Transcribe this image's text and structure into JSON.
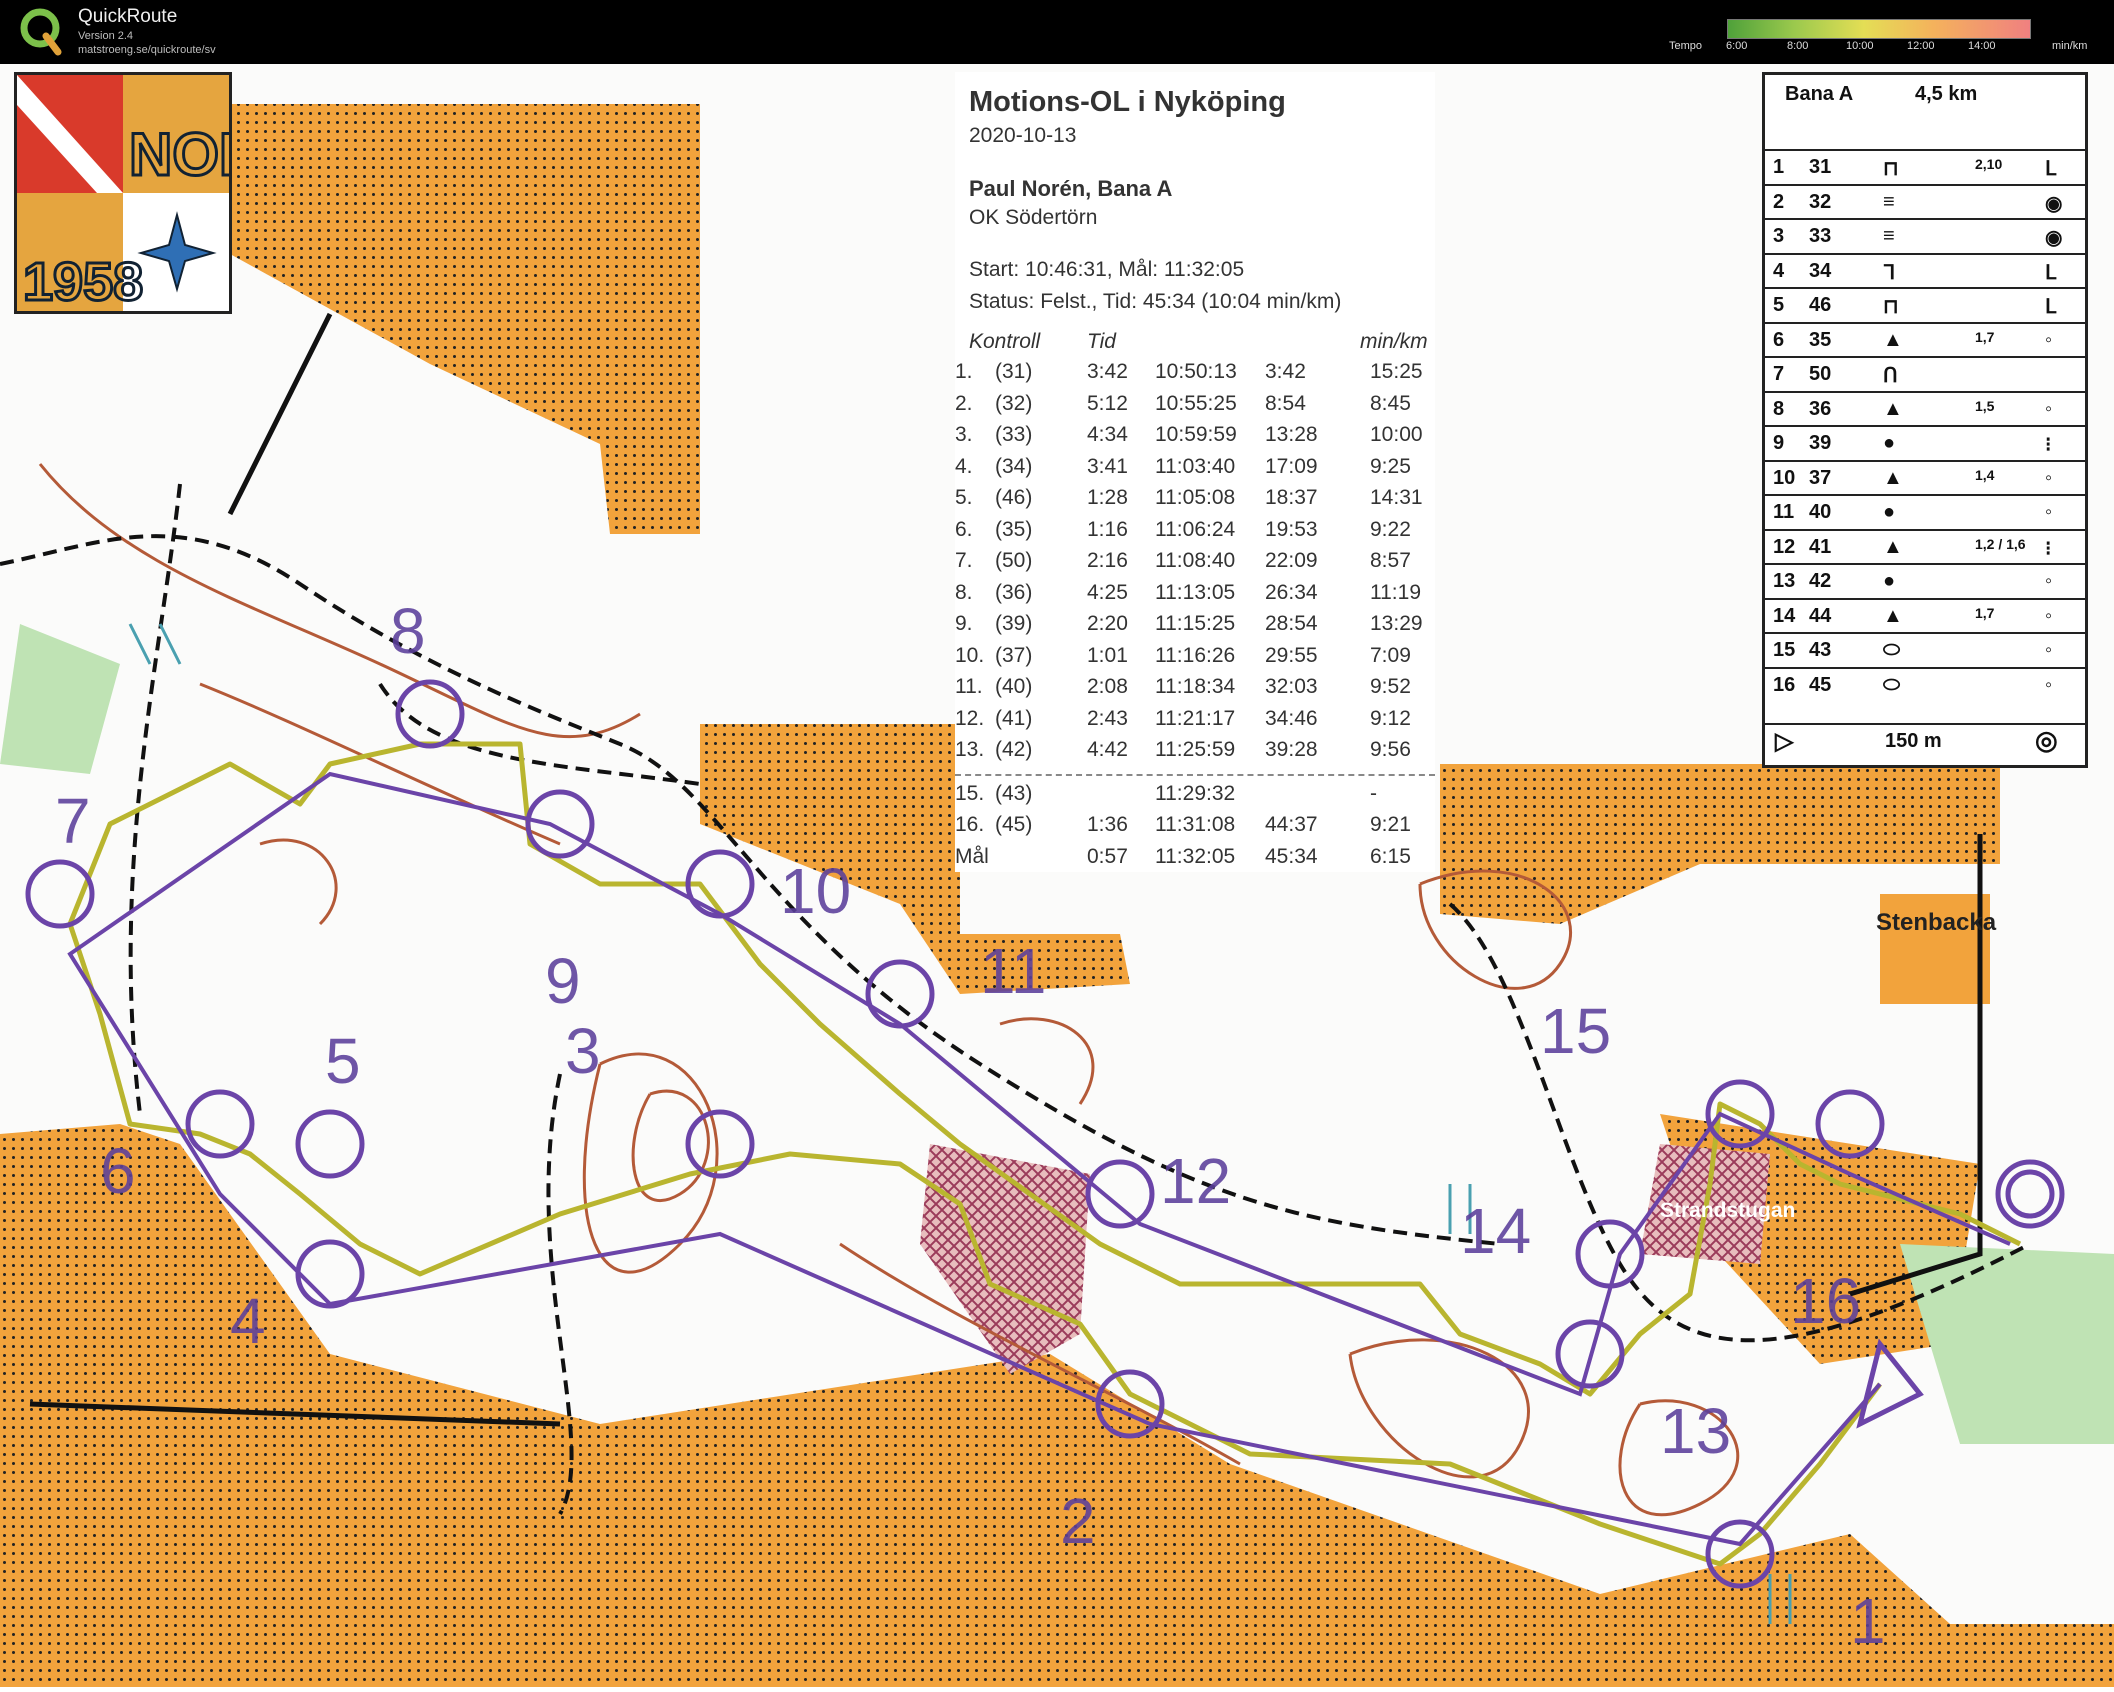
{
  "app": {
    "title": "QuickRoute",
    "version": "Version 2.4",
    "url": "matstroeng.se/quickroute/sv"
  },
  "tempo_legend": {
    "label": "Tempo",
    "ticks": [
      "6:00",
      "8:00",
      "10:00",
      "12:00",
      "14:00"
    ],
    "unit": "min/km"
  },
  "club_logo": {
    "top_text": "NOK",
    "year": "1958"
  },
  "results": {
    "title": "Motions-OL i Nyköping",
    "date": "2020-10-13",
    "runner": "Paul Norén, Bana A",
    "club": "OK Södertörn",
    "start_finish": "Start: 10:46:31, Mål: 11:32:05",
    "status": "Status: Felst., Tid: 45:34 (10:04 min/km)",
    "headers": [
      "Kontroll",
      "Tid",
      "min/km"
    ],
    "splits": [
      [
        "1.",
        "(31)",
        "3:42",
        "10:50:13",
        "3:42",
        "15:25"
      ],
      [
        "2.",
        "(32)",
        "5:12",
        "10:55:25",
        "8:54",
        "8:45"
      ],
      [
        "3.",
        "(33)",
        "4:34",
        "10:59:59",
        "13:28",
        "10:00"
      ],
      [
        "4.",
        "(34)",
        "3:41",
        "11:03:40",
        "17:09",
        "9:25"
      ],
      [
        "5.",
        "(46)",
        "1:28",
        "11:05:08",
        "18:37",
        "14:31"
      ],
      [
        "6.",
        "(35)",
        "1:16",
        "11:06:24",
        "19:53",
        "9:22"
      ],
      [
        "7.",
        "(50)",
        "2:16",
        "11:08:40",
        "22:09",
        "8:57"
      ],
      [
        "8.",
        "(36)",
        "4:25",
        "11:13:05",
        "26:34",
        "11:19"
      ],
      [
        "9.",
        "(39)",
        "2:20",
        "11:15:25",
        "28:54",
        "13:29"
      ],
      [
        "10.",
        "(37)",
        "1:01",
        "11:16:26",
        "29:55",
        "7:09"
      ],
      [
        "11.",
        "(40)",
        "2:08",
        "11:18:34",
        "32:03",
        "9:52"
      ],
      [
        "12.",
        "(41)",
        "2:43",
        "11:21:17",
        "34:46",
        "9:12"
      ],
      [
        "13.",
        "(42)",
        "4:42",
        "11:25:59",
        "39:28",
        "9:56"
      ],
      [
        "15.",
        "(43)",
        "",
        "11:29:32",
        "",
        "-"
      ],
      [
        "16.",
        "(45)",
        "1:36",
        "11:31:08",
        "44:37",
        "9:21"
      ],
      [
        "Mål",
        "",
        "0:57",
        "11:32:05",
        "45:34",
        "6:15"
      ]
    ]
  },
  "description": {
    "course": "Bana A",
    "length": "4,5 km",
    "rows": [
      [
        "1",
        "31",
        "2,10"
      ],
      [
        "2",
        "32",
        ""
      ],
      [
        "3",
        "33",
        ""
      ],
      [
        "4",
        "34",
        ""
      ],
      [
        "5",
        "46",
        ""
      ],
      [
        "6",
        "35",
        "1,7"
      ],
      [
        "7",
        "50",
        ""
      ],
      [
        "8",
        "36",
        "1,5"
      ],
      [
        "9",
        "39",
        ""
      ],
      [
        "10",
        "37",
        "1,4"
      ],
      [
        "11",
        "40",
        ""
      ],
      [
        "12",
        "41",
        "1,2 / 1,6"
      ],
      [
        "13",
        "42",
        ""
      ],
      [
        "14",
        "44",
        "1,7"
      ],
      [
        "15",
        "43",
        ""
      ],
      [
        "16",
        "45",
        ""
      ]
    ],
    "footer": "150 m"
  },
  "controls": [
    "1",
    "2",
    "3",
    "4",
    "5",
    "6",
    "7",
    "8",
    "9",
    "10",
    "11",
    "12",
    "13",
    "14",
    "15",
    "16"
  ],
  "places": [
    "Stenbacka",
    "Strandstugan"
  ],
  "colors": {
    "route": "#c9c23a",
    "course": "#6b44a8",
    "forest_open": "#f3a63c",
    "contour": "#b45a38",
    "marsh": "#4aa0b0",
    "green": "#6bb86b"
  }
}
